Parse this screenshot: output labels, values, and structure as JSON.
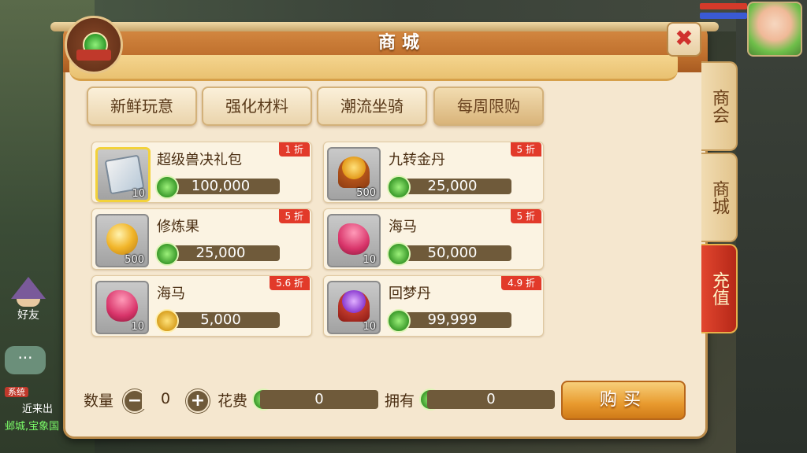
{
  "window": {
    "title": "商城",
    "close_glyph": "✖"
  },
  "categories": [
    {
      "label": "新鲜玩意",
      "active": false
    },
    {
      "label": "强化材料",
      "active": false
    },
    {
      "label": "潮流坐骑",
      "active": false
    },
    {
      "label": "每周限购",
      "active": true
    }
  ],
  "items": [
    {
      "name": "超级兽决礼包",
      "qty": "10",
      "discount": "1 折",
      "price": "100,000",
      "currency": "green-coin",
      "icon": "scroll-gift-icon",
      "selected": true
    },
    {
      "name": "九转金丹",
      "qty": "500",
      "discount": "5 折",
      "price": "25,000",
      "currency": "green-coin",
      "icon": "golden-pill-chest-icon",
      "selected": false
    },
    {
      "name": "修炼果",
      "qty": "500",
      "discount": "5 折",
      "price": "25,000",
      "currency": "green-coin",
      "icon": "golden-fruit-icon",
      "selected": false
    },
    {
      "name": "海马",
      "qty": "10",
      "discount": "5 折",
      "price": "50,000",
      "currency": "green-coin",
      "icon": "seahorse-icon",
      "selected": false
    },
    {
      "name": "海马",
      "qty": "10",
      "discount": "5.6 折",
      "price": "5,000",
      "currency": "gold-coin",
      "icon": "seahorse-icon",
      "selected": false
    },
    {
      "name": "回梦丹",
      "qty": "10",
      "discount": "4.9 折",
      "price": "99,999",
      "currency": "green-coin",
      "icon": "purple-pearl-chest-icon",
      "selected": false
    }
  ],
  "bottom": {
    "quantity_label": "数量",
    "quantity_value": "0",
    "minus": "−",
    "plus": "+",
    "cost_label": "花费",
    "cost_value": "0",
    "owned_label": "拥有",
    "owned_value": "0",
    "buy_label": "购买"
  },
  "side_tabs": [
    "商会",
    "商城",
    "充值"
  ],
  "background": {
    "friend_label": "好友",
    "chat_bubble": "···",
    "chat_tag": "系统",
    "chat_line1": "近来出",
    "chat_line2": "邺城,宝象国"
  },
  "colors": {
    "accent": "#c0712e",
    "discount_badge": "#e23a2a",
    "price_bar": "#6f5a3a",
    "recharge_tab": "#b52818"
  }
}
